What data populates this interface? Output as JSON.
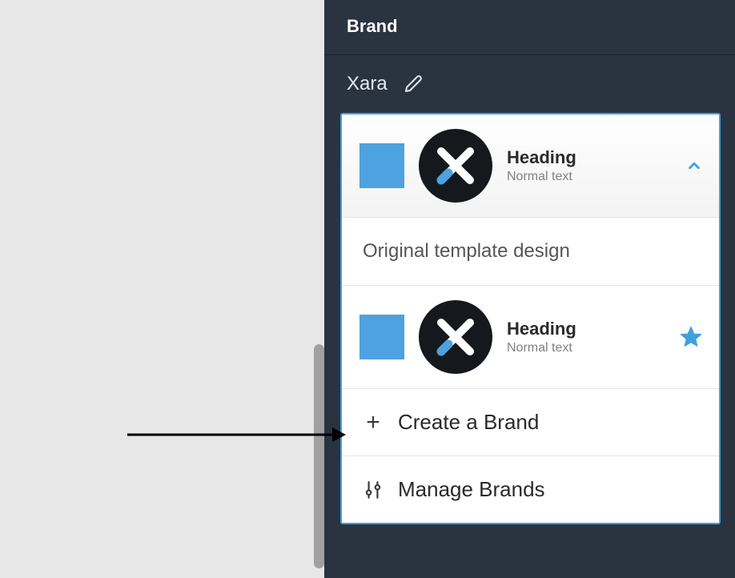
{
  "sidebar": {
    "title": "Brand",
    "brand_name": "Xara",
    "selected_card": {
      "heading": "Heading",
      "subtext": "Normal text",
      "swatch_color": "#4da2df"
    },
    "section_label": "Original template design",
    "option_card": {
      "heading": "Heading",
      "subtext": "Normal text",
      "swatch_color": "#4da2df"
    },
    "actions": {
      "create": "Create a Brand",
      "manage": "Manage Brands"
    }
  }
}
